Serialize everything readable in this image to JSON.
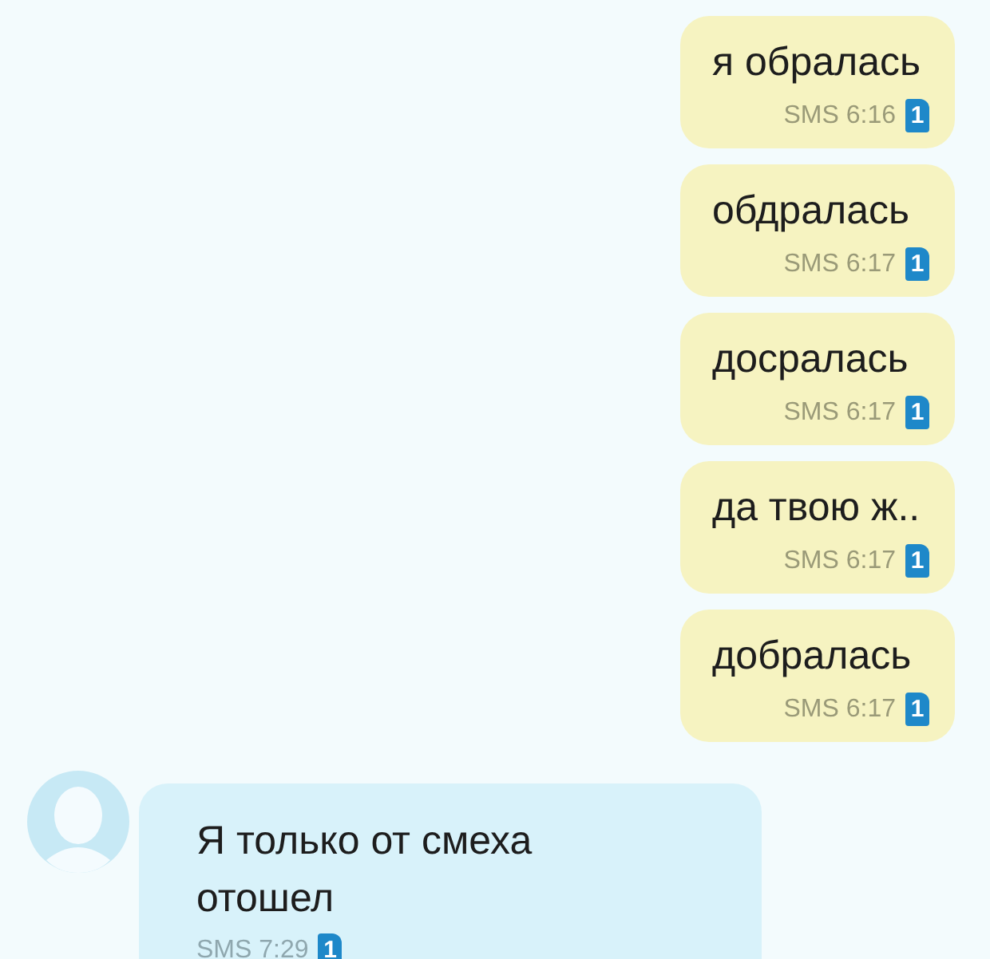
{
  "messages": [
    {
      "kind": "outgoing",
      "text": "я обралась",
      "meta": "SMS 6:16",
      "sim": "1"
    },
    {
      "kind": "outgoing",
      "text": "обдралась",
      "meta": "SMS 6:17",
      "sim": "1"
    },
    {
      "kind": "outgoing",
      "text": "досралась",
      "meta": "SMS 6:17",
      "sim": "1"
    },
    {
      "kind": "outgoing",
      "text": "да твою ж..",
      "meta": "SMS 6:17",
      "sim": "1"
    },
    {
      "kind": "outgoing",
      "text": "добралась",
      "meta": "SMS 6:17",
      "sim": "1"
    },
    {
      "kind": "incoming",
      "text": "Я только от смеха отошел",
      "meta": "SMS 7:29",
      "sim": "1"
    }
  ]
}
